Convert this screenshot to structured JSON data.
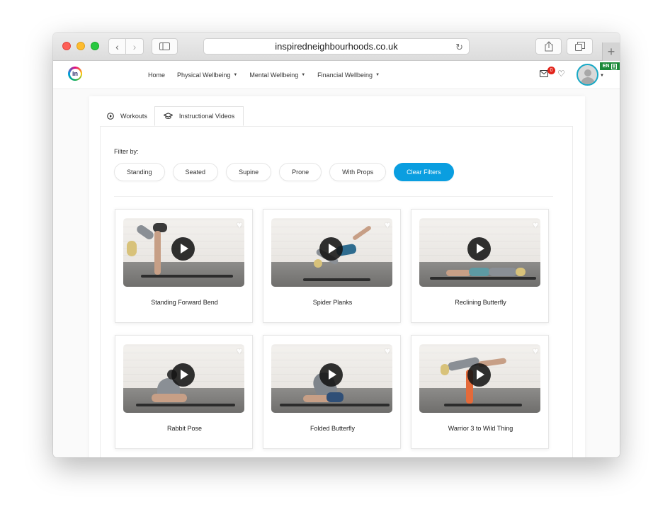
{
  "browser": {
    "url": "inspiredneighbourhoods.co.uk",
    "back_icon": "chevron-left-icon",
    "forward_icon": "chevron-right-icon",
    "new_tab_label": "+"
  },
  "header": {
    "logo_text": "in",
    "nav": [
      {
        "label": "Home",
        "dropdown": false
      },
      {
        "label": "Physical Wellbeing",
        "dropdown": true
      },
      {
        "label": "Mental Wellbeing",
        "dropdown": true
      },
      {
        "label": "Financial Wellbeing",
        "dropdown": true
      }
    ],
    "mail_count": "0",
    "language": "EN"
  },
  "tabs": [
    {
      "label": "Workouts",
      "icon": "play-circle-icon",
      "active": false
    },
    {
      "label": "Instructional Videos",
      "icon": "graduation-cap-icon",
      "active": true
    }
  ],
  "filter": {
    "label": "Filter by:",
    "chips": [
      "Standing",
      "Seated",
      "Supine",
      "Prone",
      "With Props"
    ],
    "clear_label": "Clear Filters"
  },
  "videos": [
    {
      "title": "Standing Forward Bend"
    },
    {
      "title": "Spider Planks"
    },
    {
      "title": "Reclining Butterfly"
    },
    {
      "title": "Rabbit Pose"
    },
    {
      "title": "Folded Butterfly"
    },
    {
      "title": "Warrior 3 to Wild Thing"
    }
  ],
  "colors": {
    "accent": "#0a9ee0",
    "badge": "#e2231a",
    "language_badge": "#1c8a3a",
    "avatar_ring": "#18a9c6"
  }
}
